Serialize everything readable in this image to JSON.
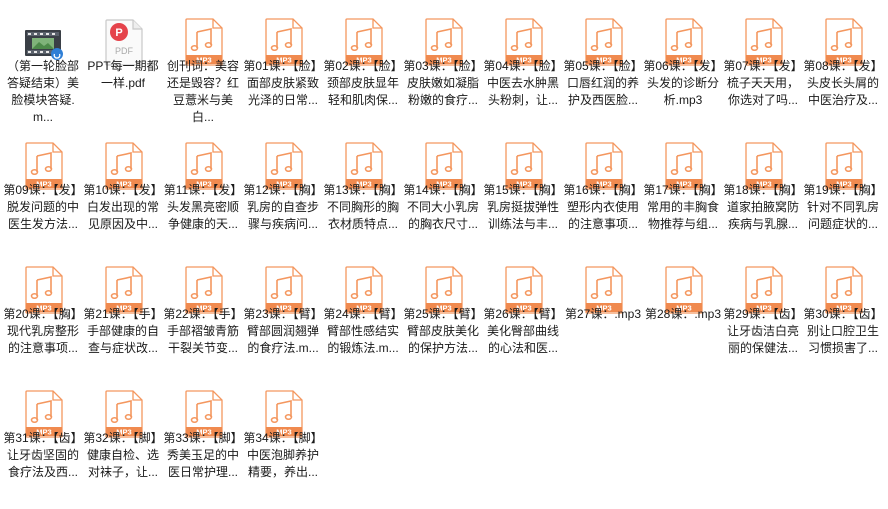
{
  "colors": {
    "mp3_accent": "#f4975f",
    "mp3_band": "#f08a4f",
    "pdf_accent": "#e5434b",
    "text": "#1a1a1a",
    "background": "#ffffff"
  },
  "files": [
    {
      "icon": "video-file-icon",
      "label": "（第一轮脸部答疑结束）美脸模块答疑.m..."
    },
    {
      "icon": "pdf-file-icon",
      "label": "PPT每一期都一样.pdf"
    },
    {
      "icon": "mp3-file-icon",
      "label": "创刊词：美容还是毁容？红豆薏米与美白..."
    },
    {
      "icon": "mp3-file-icon",
      "label": "第01课：【脸】面部皮肤紧致光泽的日常..."
    },
    {
      "icon": "mp3-file-icon",
      "label": "第02课：【脸】颈部皮肤显年轻和肌肉保..."
    },
    {
      "icon": "mp3-file-icon",
      "label": "第03课：【脸】皮肤嫩如凝脂粉嫩的食疗..."
    },
    {
      "icon": "mp3-file-icon",
      "label": "第04课：【脸】中医去水肿黑头粉刺，让..."
    },
    {
      "icon": "mp3-file-icon",
      "label": "第05课：【脸】口唇红润的养护及西医脸..."
    },
    {
      "icon": "mp3-file-icon",
      "label": "第06课：【发】头发的诊断分析.mp3"
    },
    {
      "icon": "mp3-file-icon",
      "label": "第07课：【发】梳子天天用，你选对了吗..."
    },
    {
      "icon": "mp3-file-icon",
      "label": "第08课：【发】头皮长头屑的中医治疗及..."
    },
    {
      "icon": "mp3-file-icon",
      "label": "第09课：【发】脱发问题的中医生发方法..."
    },
    {
      "icon": "mp3-file-icon",
      "label": "第10课：【发】白发出现的常见原因及中..."
    },
    {
      "icon": "mp3-file-icon",
      "label": "第11课：【发】头发黑亮密顺争健康的天..."
    },
    {
      "icon": "mp3-file-icon",
      "label": "第12课：【胸】乳房的自查步骤与疾病问..."
    },
    {
      "icon": "mp3-file-icon",
      "label": "第13课：【胸】不同胸形的胸衣材质特点..."
    },
    {
      "icon": "mp3-file-icon",
      "label": "第14课：【胸】不同大小乳房的胸衣尺寸..."
    },
    {
      "icon": "mp3-file-icon",
      "label": "第15课：【胸】乳房挺拔弹性训练法与丰..."
    },
    {
      "icon": "mp3-file-icon",
      "label": "第16课：【胸】塑形内衣使用的注意事项..."
    },
    {
      "icon": "mp3-file-icon",
      "label": "第17课：【胸】常用的丰胸食物推荐与组..."
    },
    {
      "icon": "mp3-file-icon",
      "label": "第18课：【胸】道家拍腋窝防疾病与乳腺..."
    },
    {
      "icon": "mp3-file-icon",
      "label": "第19课：【胸】针对不同乳房问题症状的..."
    },
    {
      "icon": "mp3-file-icon",
      "label": "第20课：【胸】现代乳房整形的注意事项..."
    },
    {
      "icon": "mp3-file-icon",
      "label": "第21课：【手】手部健康的自查与症状改..."
    },
    {
      "icon": "mp3-file-icon",
      "label": "第22课：【手】手部褶皱青筋干裂关节变..."
    },
    {
      "icon": "mp3-file-icon",
      "label": "第23课：【臂】臂部圆润翘弹的食疗法.m..."
    },
    {
      "icon": "mp3-file-icon",
      "label": "第24课：【臂】臂部性感结实的锻炼法.m..."
    },
    {
      "icon": "mp3-file-icon",
      "label": "第25课：【臂】臂部皮肤美化的保护方法..."
    },
    {
      "icon": "mp3-file-icon",
      "label": "第26课：【臂】美化臀部曲线的心法和医..."
    },
    {
      "icon": "mp3-file-icon",
      "label": "第27课：.mp3"
    },
    {
      "icon": "mp3-file-icon",
      "label": "第28课：.mp3"
    },
    {
      "icon": "mp3-file-icon",
      "label": "第29课：【齿】让牙齿洁白亮丽的保健法..."
    },
    {
      "icon": "mp3-file-icon",
      "label": "第30课：【齿】别让口腔卫生习惯损害了..."
    },
    {
      "icon": "mp3-file-icon",
      "label": "第31课：【齿】让牙齿坚固的食疗法及西..."
    },
    {
      "icon": "mp3-file-icon",
      "label": "第32课：【脚】健康自检、选对袜子，让..."
    },
    {
      "icon": "mp3-file-icon",
      "label": "第33课：【脚】秀美玉足的中医日常护理..."
    },
    {
      "icon": "mp3-file-icon",
      "label": "第34课：【脚】中医泡脚养护精要，养出..."
    }
  ],
  "icon_texts": {
    "mp3": "MP3",
    "pdf": "PDF"
  }
}
